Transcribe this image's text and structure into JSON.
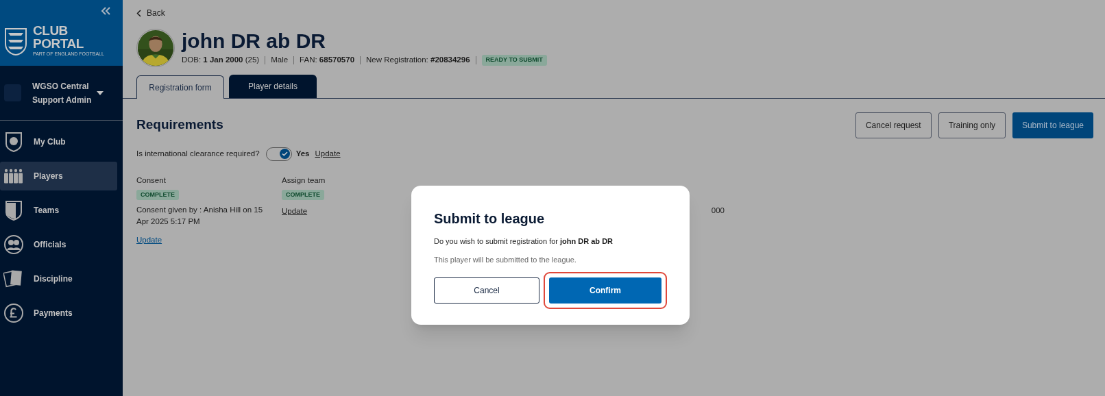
{
  "sidebar": {
    "logo": {
      "lines": [
        "CLUB",
        "PORTAL"
      ],
      "tagline": "PART OF ENGLAND FOOTBALL"
    },
    "account": {
      "lines": [
        "WGSO Central",
        "Support Admin"
      ]
    },
    "nav": [
      {
        "kind": "club",
        "label": "My Club",
        "selected": false
      },
      {
        "kind": "players",
        "label": "Players",
        "selected": true
      },
      {
        "kind": "teams",
        "label": "Teams",
        "selected": false
      },
      {
        "kind": "officials",
        "label": "Officials",
        "selected": false
      },
      {
        "kind": "discipline",
        "label": "Discipline",
        "selected": false
      },
      {
        "kind": "payments",
        "label": "Payments",
        "selected": false
      }
    ]
  },
  "header": {
    "back": "Back",
    "name": "john DR ab DR",
    "meta": [
      {
        "label": "DOB:",
        "value": "1 Jan 2000",
        "extra": "(25)"
      },
      {
        "extra": "Male"
      },
      {
        "label": "FAN:",
        "value": "68570570"
      },
      {
        "label": "New Registration:",
        "value": "#20834296"
      }
    ],
    "status": "READY TO SUBMIT"
  },
  "tabs": [
    {
      "label": "Registration form",
      "selected": true
    },
    {
      "label": "Player details",
      "selected": false
    }
  ],
  "actions": [
    {
      "kind": "outline",
      "label": "Cancel request"
    },
    {
      "kind": "outline",
      "label": "Training only"
    },
    {
      "kind": "primary",
      "label": "Submit to league"
    }
  ],
  "requirements": {
    "title": "Requirements",
    "clearance": {
      "question": "Is international clearance required?",
      "on": true,
      "answer": "Yes",
      "link": "Update"
    },
    "columns": [
      {
        "heading": "Consent",
        "status": "COMPLETE",
        "details": "Consent given by : Anisha Hill on 15 Apr 2025 5:17 PM",
        "link": "Update",
        "kind": "primary"
      },
      {
        "heading": "Assign team",
        "status": "COMPLETE",
        "link": "Update",
        "kind": "plain"
      },
      {},
      {
        "details": "000"
      }
    ]
  },
  "modal": {
    "title": "Submit to league",
    "message": "Do you wish to submit registration for **john DR ab DR**",
    "note": "This player will be submitted to the league.",
    "cancel": "Cancel",
    "confirm": "Confirm",
    "confirm_highlighted": true
  }
}
